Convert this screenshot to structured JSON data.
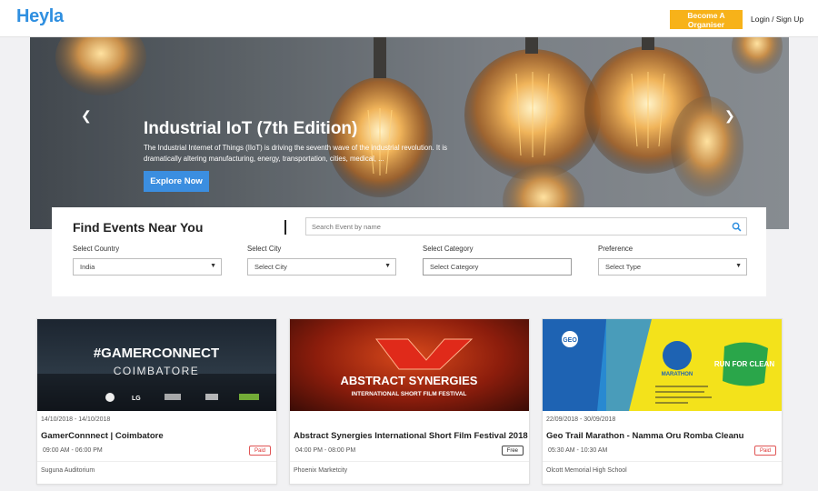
{
  "header": {
    "logo": "Heyla",
    "organiser_label": "Become A Organiser",
    "login_label": "Login / Sign Up",
    "accent": "#f7b219",
    "brand": "#2f8fe0"
  },
  "hero": {
    "title": "Industrial IoT (7th Edition)",
    "description": "The Industrial Internet of Things (IIoT) is driving the seventh wave of the industrial revolution. It is dramatically altering manufacturing, energy, transportation, cities, medical, ...",
    "cta": "Explore Now",
    "prev_icon": "chevron-left-icon",
    "next_icon": "chevron-right-icon"
  },
  "finder": {
    "title": "Find Events Near You",
    "search_placeholder": "Search Event by name",
    "filters": [
      {
        "label": "Select Country",
        "value": "India"
      },
      {
        "label": "Select City",
        "value": "Select City"
      },
      {
        "label": "Select Category",
        "value": "Select Category"
      },
      {
        "label": "Preference",
        "value": "Select Type"
      }
    ]
  },
  "events": [
    {
      "image_text": "#GAMERCONNECT",
      "image_sub": "COIMBATORE",
      "image_sponsor": "LG",
      "date": "14/10/2018 - 14/10/2018",
      "title": "GamerConnnect | Coimbatore",
      "time": "09:00 AM - 06:00 PM",
      "badge": "Paid",
      "venue": "Suguna Auditorium"
    },
    {
      "image_text": "ABSTRACT SYNERGIES",
      "image_sub": "INTERNATIONAL SHORT FILM FESTIVAL",
      "date": "",
      "title": "Abstract Synergies International Short Film Festival 2018",
      "time": "04:00 PM - 08:00 PM",
      "badge": "Free",
      "venue": "Phoenix Marketcity"
    },
    {
      "image_text": "RUN FOR CLEAN",
      "image_sub": "GEO",
      "image_marathon": "MARATHON",
      "date": "22/09/2018 - 30/09/2018",
      "title": "Geo Trail Marathon - Namma Oru Romba Cleanu",
      "time": "05:30 AM - 10:30 AM",
      "badge": "Paid",
      "venue": "Olcott Memorial High School"
    }
  ]
}
